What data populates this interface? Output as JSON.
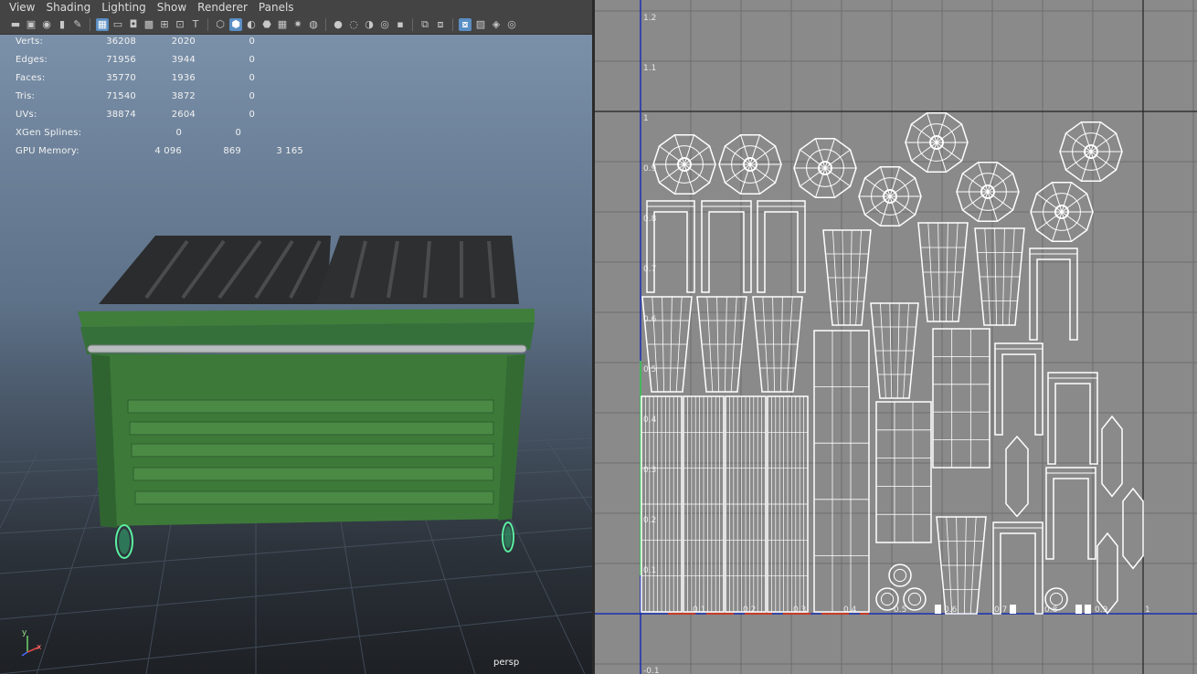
{
  "menu": [
    "View",
    "Shading",
    "Lighting",
    "Show",
    "Renderer",
    "Panels"
  ],
  "toolbar_icons": [
    "camera-icon",
    "camera-attr-icon",
    "bookmark-icon",
    "image-plane-icon",
    "grease-pencil-icon",
    "sep",
    "grid-icon",
    "film-gate-icon",
    "resolution-gate-icon",
    "gate-mask-icon",
    "field-chart-icon",
    "safe-action-icon",
    "safe-title-icon",
    "sep",
    "wireframe-icon",
    "smooth-shade-icon",
    "default-material-icon",
    "wireframe-on-shaded-icon",
    "textured-icon",
    "use-all-lights-icon",
    "shadows-icon",
    "sep",
    "ambient-occlusion-icon",
    "motion-blur-icon",
    "anti-alias-icon",
    "depth-of-field-icon",
    "xray-icon",
    "sep",
    "isolate-select-icon",
    "xray-joints-icon",
    "sep",
    "xray-active-icon",
    "backface-icon",
    "texture-border-icon",
    "exposure-icon"
  ],
  "hud": {
    "verts": {
      "label": "Verts:",
      "values": [
        "36208",
        "2020",
        "0"
      ]
    },
    "edges": {
      "label": "Edges:",
      "values": [
        "71956",
        "3944",
        "0"
      ]
    },
    "faces": {
      "label": "Faces:",
      "values": [
        "35770",
        "1936",
        "0"
      ]
    },
    "tris": {
      "label": "Tris:",
      "values": [
        "71540",
        "3872",
        "0"
      ]
    },
    "uvs": {
      "label": "UVs:",
      "values": [
        "38874",
        "2604",
        "0"
      ]
    },
    "xgen": {
      "label": "XGen Splines:",
      "values": [
        "0",
        "0"
      ]
    },
    "gpu": {
      "label": "GPU Memory:",
      "values": [
        "4 096",
        "869",
        "3 165"
      ]
    }
  },
  "camera_label": "persp",
  "axis": {
    "y": "y",
    "x": "x"
  },
  "uv_axis_labels": {
    "v": [
      "1.2",
      "1.1",
      "1",
      "0.9",
      "0.8",
      "0.7",
      "0.6",
      "0.5",
      "0.4",
      "0.3",
      "0.2",
      "0.1",
      "-0.1"
    ],
    "u": [
      "0.1",
      "0.1",
      "0.2",
      "0.3",
      "0.4",
      "0.5",
      "0.6",
      "0.7",
      "0.8",
      "0.9",
      "1"
    ]
  },
  "colors": {
    "dumpster_green": "#3e7d3a",
    "lid_dark": "#2b2d2e",
    "uv_bg": "#8a8a8a",
    "uv_wire": "#ffffff",
    "uv_axis_blue": "#1a2fb0",
    "selection_green": "#5af0a0"
  }
}
